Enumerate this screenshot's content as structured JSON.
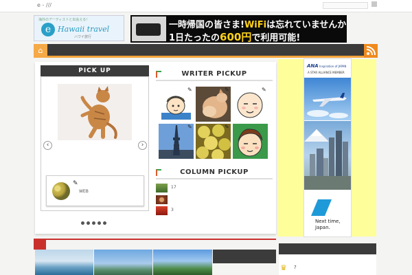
{
  "site": {
    "title": "e - ///"
  },
  "banners": {
    "hawaii": {
      "tagline": "海外のアーティストと出会える!",
      "logo_letter": "e",
      "brand": "Hawaii travel",
      "sub": "ハワイ旅行"
    },
    "wifi": {
      "line1_pre": "一時帰国の皆さま!",
      "line1_hl": "WiFi",
      "line1_post": "は忘れていませんか!?",
      "line2_pre": "1日たったの",
      "line2_hl": "600円",
      "line2_post": "で利用可能!"
    }
  },
  "nav": {
    "home_icon": "⌂",
    "rss_icon": "rss"
  },
  "pickup": {
    "heading": "PICK UP",
    "prev_arrow": "‹",
    "next_arrow": "›",
    "card_label": "WEB",
    "pen": "✎",
    "slide_count": 5
  },
  "writer_pickup": {
    "heading": "WRITER PICKUP"
  },
  "column_pickup": {
    "heading": "COLUMN PICKUP",
    "items": [
      {
        "num": "17"
      },
      {
        "num": ""
      },
      {
        "num": "3"
      }
    ]
  },
  "ad": {
    "brand": "ANA",
    "brand_sub": "Inspiration of JAPAN",
    "alliance": "A STAR ALLIANCE MEMBER",
    "next_line1": "Next time,",
    "next_line2": "Japan."
  },
  "sidebar": {
    "crown_icon": "♛",
    "rank_text": "?"
  },
  "colors": {
    "accent": "#f2a33a",
    "dark": "#3b3b3b",
    "ad_bg": "#fefe9a",
    "red": "#c9302c"
  }
}
